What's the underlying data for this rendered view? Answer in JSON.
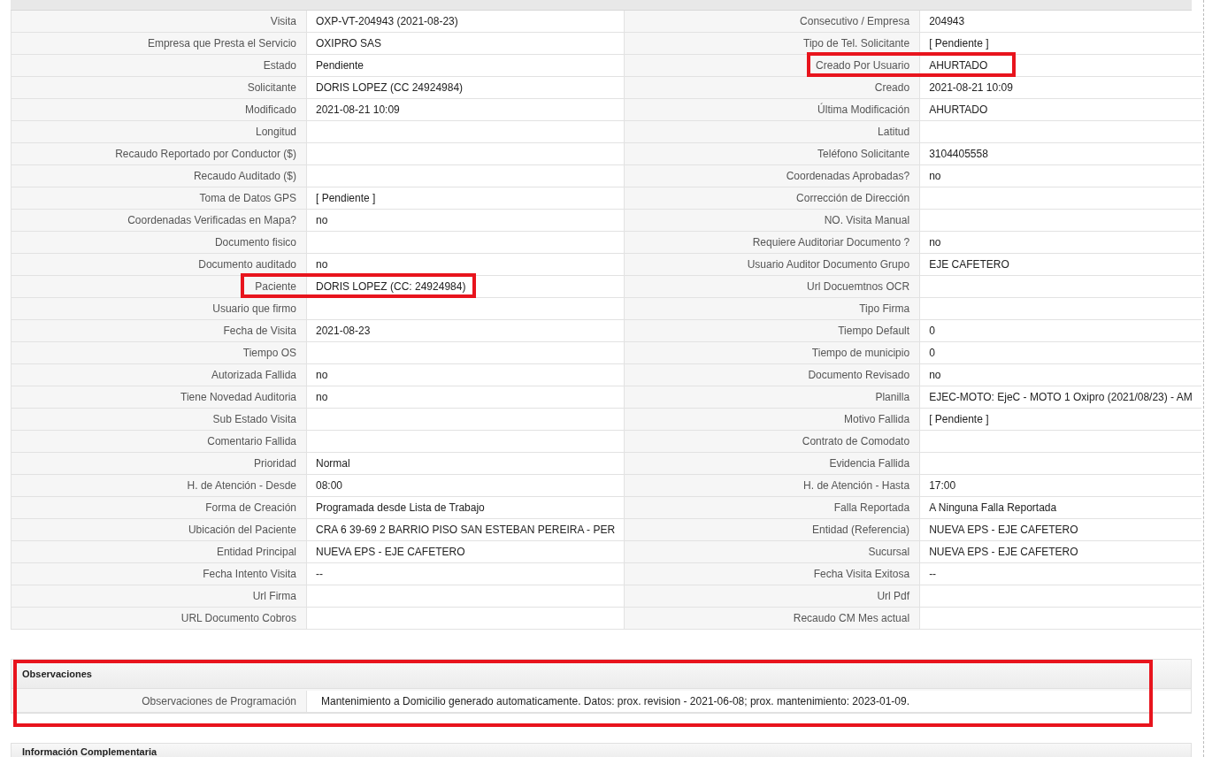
{
  "details": {
    "rows": [
      {
        "left": {
          "label": "Visita",
          "value": "OXP-VT-204943 (2021-08-23)"
        },
        "right": {
          "label": "Consecutivo / Empresa",
          "value": "204943"
        }
      },
      {
        "left": {
          "label": "Empresa que Presta el Servicio",
          "value": "OXIPRO SAS"
        },
        "right": {
          "label": "Tipo de Tel. Solicitante",
          "value": "[ Pendiente ]"
        }
      },
      {
        "left": {
          "label": "Estado",
          "value": "Pendiente"
        },
        "right": {
          "label": "Creado Por Usuario",
          "value": "AHURTADO",
          "highlighted": true
        }
      },
      {
        "left": {
          "label": "Solicitante",
          "value": "DORIS LOPEZ (CC 24924984)"
        },
        "right": {
          "label": "Creado",
          "value": "2021-08-21 10:09"
        }
      },
      {
        "left": {
          "label": "Modificado",
          "value": "2021-08-21 10:09"
        },
        "right": {
          "label": "Última Modificación",
          "value": "AHURTADO"
        }
      },
      {
        "left": {
          "label": "Longitud"
        },
        "right": {
          "label": "Latitud"
        }
      },
      {
        "left": {
          "label": "Recaudo Reportado por Conductor ($)"
        },
        "right": {
          "label": "Teléfono Solicitante",
          "value": "3104405558"
        }
      },
      {
        "left": {
          "label": "Recaudo Auditado ($)"
        },
        "right": {
          "label": "Coordenadas Aprobadas?",
          "value": "no"
        }
      },
      {
        "left": {
          "label": "Toma de Datos GPS",
          "value": "[ Pendiente ]"
        },
        "right": {
          "label": "Corrección de Dirección"
        }
      },
      {
        "left": {
          "label": "Coordenadas Verificadas en Mapa?",
          "value": "no"
        },
        "right": {
          "label": "NO. Visita Manual"
        }
      },
      {
        "left": {
          "label": "Documento fisico"
        },
        "right": {
          "label": "Requiere Auditoriar Documento ?",
          "value": "no"
        }
      },
      {
        "left": {
          "label": "Documento auditado",
          "value": "no"
        },
        "right": {
          "label": "Usuario Auditor Documento Grupo",
          "value": "EJE CAFETERO"
        }
      },
      {
        "left": {
          "label": "Paciente",
          "value": "DORIS LOPEZ (CC: 24924984)",
          "highlighted": true
        },
        "right": {
          "label": "Url Docuemtnos OCR"
        }
      },
      {
        "left": {
          "label": "Usuario que firmo"
        },
        "right": {
          "label": "Tipo Firma"
        }
      },
      {
        "left": {
          "label": "Fecha de Visita",
          "value": "2021-08-23"
        },
        "right": {
          "label": "Tiempo Default",
          "value": "0"
        }
      },
      {
        "left": {
          "label": "Tiempo OS"
        },
        "right": {
          "label": "Tiempo de municipio",
          "value": "0"
        }
      },
      {
        "left": {
          "label": "Autorizada Fallida",
          "value": "no"
        },
        "right": {
          "label": "Documento Revisado",
          "value": "no"
        }
      },
      {
        "left": {
          "label": "Tiene Novedad Auditoria",
          "value": "no"
        },
        "right": {
          "label": "Planilla",
          "value": "EJEC-MOTO: EjeC - MOTO 1 Oxipro (2021/08/23) - AM"
        }
      },
      {
        "left": {
          "label": "Sub Estado Visita"
        },
        "right": {
          "label": "Motivo Fallida",
          "value": "[ Pendiente ]"
        }
      },
      {
        "left": {
          "label": "Comentario Fallida"
        },
        "right": {
          "label": "Contrato de Comodato"
        }
      },
      {
        "left": {
          "label": "Prioridad",
          "value": "Normal"
        },
        "right": {
          "label": "Evidencia Fallida"
        }
      },
      {
        "left": {
          "label": "H. de Atención - Desde",
          "value": "08:00"
        },
        "right": {
          "label": "H. de Atención - Hasta",
          "value": "17:00"
        }
      },
      {
        "left": {
          "label": "Forma de Creación",
          "value": "Programada desde Lista de Trabajo"
        },
        "right": {
          "label": "Falla Reportada",
          "value": "A Ninguna Falla Reportada"
        }
      },
      {
        "left": {
          "label": "Ubicación del Paciente",
          "value": "CRA 6 39-69 2 BARRIO PISO SAN ESTEBAN PEREIRA - PER"
        },
        "right": {
          "label": "Entidad (Referencia)",
          "value": "NUEVA EPS - EJE CAFETERO"
        }
      },
      {
        "left": {
          "label": "Entidad Principal",
          "value": "NUEVA EPS - EJE CAFETERO"
        },
        "right": {
          "label": "Sucursal",
          "value": "NUEVA EPS - EJE CAFETERO"
        }
      },
      {
        "left": {
          "label": "Fecha Intento Visita",
          "value": "--"
        },
        "right": {
          "label": "Fecha Visita Exitosa",
          "value": "--"
        }
      },
      {
        "left": {
          "label": "Url Firma"
        },
        "right": {
          "label": "Url Pdf"
        }
      },
      {
        "left": {
          "label": "URL Documento Cobros"
        },
        "right": {
          "label": "Recaudo CM Mes actual"
        }
      }
    ]
  },
  "observaciones": {
    "title": "Observaciones",
    "highlighted": true,
    "rows": [
      {
        "label": "Observaciones de Programación",
        "value": "Mantenimiento a Domicilio generado automaticamente. Datos: prox. revision - 2021-06-08; prox. mantenimiento: 2023-01-09."
      }
    ]
  },
  "complementaria": {
    "title": "Información Complementaria"
  }
}
